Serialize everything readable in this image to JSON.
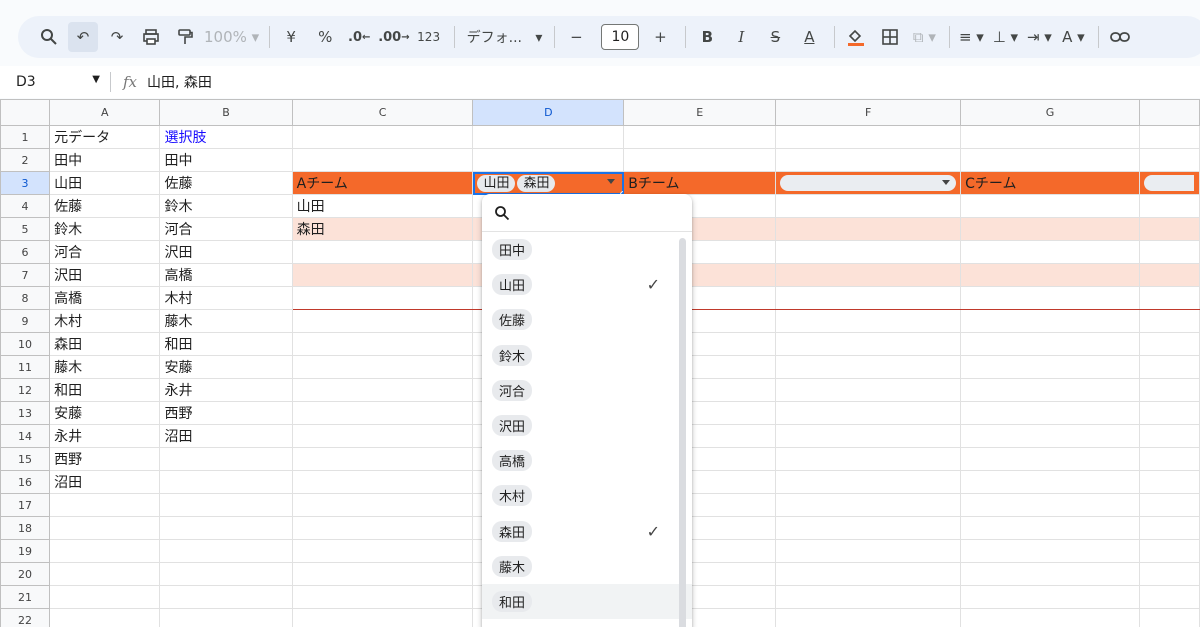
{
  "toolbar": {
    "zoom": "100%",
    "currency": "¥",
    "percent": "%",
    "dec_decrease": ".0",
    "dec_increase": ".00",
    "number_format": "123",
    "font_name": "デフォ...",
    "font_size": "10"
  },
  "formula_bar": {
    "cell_ref": "D3",
    "fx": "fx",
    "value": "山田, 森田"
  },
  "columns": [
    "A",
    "B",
    "C",
    "D",
    "E",
    "F",
    "G"
  ],
  "rows": [
    {
      "n": "1",
      "a": "元データ",
      "b": "選択肢"
    },
    {
      "n": "2",
      "a": "田中",
      "b": "田中"
    },
    {
      "n": "3",
      "a": "山田",
      "b": "佐藤"
    },
    {
      "n": "4",
      "a": "佐藤",
      "b": "鈴木"
    },
    {
      "n": "5",
      "a": "鈴木",
      "b": "河合"
    },
    {
      "n": "6",
      "a": "河合",
      "b": "沢田"
    },
    {
      "n": "7",
      "a": "沢田",
      "b": "高橋"
    },
    {
      "n": "8",
      "a": "高橋",
      "b": "木村"
    },
    {
      "n": "9",
      "a": "木村",
      "b": "藤木"
    },
    {
      "n": "10",
      "a": "森田",
      "b": "和田"
    },
    {
      "n": "11",
      "a": "藤木",
      "b": "安藤"
    },
    {
      "n": "12",
      "a": "和田",
      "b": "永井"
    },
    {
      "n": "13",
      "a": "安藤",
      "b": "西野"
    },
    {
      "n": "14",
      "a": "永井",
      "b": "沼田"
    },
    {
      "n": "15",
      "a": "西野",
      "b": ""
    },
    {
      "n": "16",
      "a": "沼田",
      "b": ""
    },
    {
      "n": "17",
      "a": "",
      "b": ""
    },
    {
      "n": "18",
      "a": "",
      "b": ""
    },
    {
      "n": "19",
      "a": "",
      "b": ""
    },
    {
      "n": "20",
      "a": "",
      "b": ""
    },
    {
      "n": "21",
      "a": "",
      "b": ""
    },
    {
      "n": "22",
      "a": "",
      "b": ""
    }
  ],
  "teams": {
    "a_label": "Aチーム",
    "b_label": "Bチーム",
    "c_label": "Cチーム",
    "a_members": [
      "山田",
      "森田"
    ],
    "d3_chips": [
      "山田",
      "森田"
    ]
  },
  "dropdown": {
    "items": [
      {
        "label": "田中",
        "checked": false
      },
      {
        "label": "山田",
        "checked": true
      },
      {
        "label": "佐藤",
        "checked": false
      },
      {
        "label": "鈴木",
        "checked": false
      },
      {
        "label": "河合",
        "checked": false
      },
      {
        "label": "沢田",
        "checked": false
      },
      {
        "label": "高橋",
        "checked": false
      },
      {
        "label": "木村",
        "checked": false
      },
      {
        "label": "森田",
        "checked": true
      },
      {
        "label": "藤木",
        "checked": false
      },
      {
        "label": "和田",
        "checked": false
      }
    ],
    "check_glyph": "✓"
  }
}
